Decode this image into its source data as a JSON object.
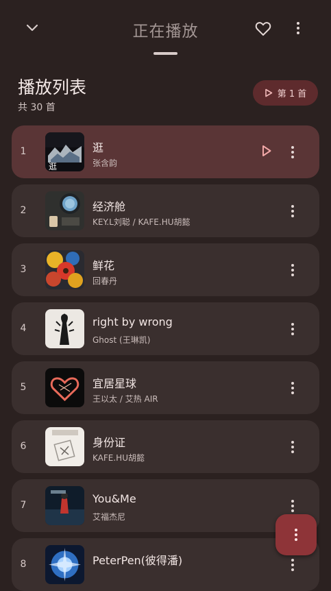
{
  "header": {
    "title": "正在播放",
    "collapse_icon": "chevron-down-icon",
    "favorite_icon": "heart-outline-icon",
    "menu_icon": "more-vert-icon"
  },
  "playlist": {
    "title": "播放列表",
    "count_label": "共 30 首",
    "play_chip_label": "第 1 首"
  },
  "tracks": [
    {
      "index": "1",
      "title": "逛",
      "artist": "张含韵",
      "active": true
    },
    {
      "index": "2",
      "title": "经济舱",
      "artist": "KEY.L刘聪 / KAFE.HU胡懿"
    },
    {
      "index": "3",
      "title": "鲜花",
      "artist": "回春丹"
    },
    {
      "index": "4",
      "title": "right by wrong",
      "artist": "Ghost (王琳凯)"
    },
    {
      "index": "5",
      "title": "宜居星球",
      "artist": "王以太 / 艾热 AIR"
    },
    {
      "index": "6",
      "title": "身份证",
      "artist": "KAFE.HU胡懿"
    },
    {
      "index": "7",
      "title": "You&Me",
      "artist": "艾福杰尼"
    },
    {
      "index": "8",
      "title": "PeterPen(彼得潘)",
      "artist": ""
    }
  ],
  "colors": {
    "background": "#2b2120",
    "card": "#3a2f2e",
    "active_card": "#5a3536",
    "accent": "#8e3438"
  }
}
